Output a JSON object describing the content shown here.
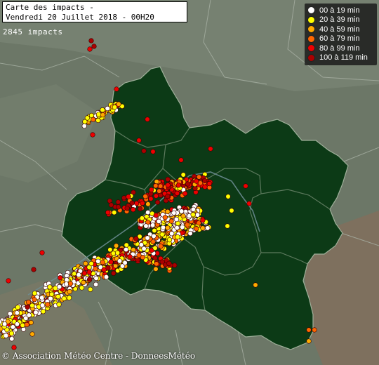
{
  "map": {
    "title_line1": "Carte des impacts -",
    "title_line2": "Vendredi 20 Juillet 2018 - 00H20",
    "impact_count": "2845 impacts",
    "credit": "© Association Météo Centre - DonneesMétéo",
    "region_color": "#0c3a16",
    "background_color": "#6f7a6a"
  },
  "legend": [
    {
      "label": "00 à 19 min",
      "color": "#ffffff"
    },
    {
      "label": "20 à 39 min",
      "color": "#ffff00"
    },
    {
      "label": "40 à 59 min",
      "color": "#ffaa00"
    },
    {
      "label": "60 à 79 min",
      "color": "#ff6600"
    },
    {
      "label": "80 à 99 min",
      "color": "#ee0000"
    },
    {
      "label": "100 à 119 min",
      "color": "#aa0000"
    }
  ]
}
